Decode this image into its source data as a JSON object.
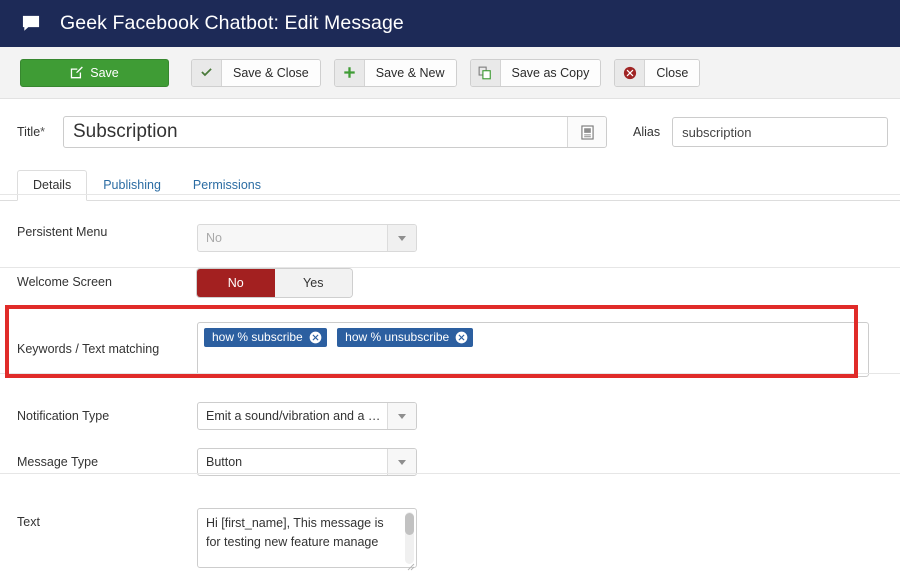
{
  "header": {
    "icon": "comment-icon",
    "title": "Geek Facebook Chatbot: Edit Message",
    "background": "#1d2a57"
  },
  "toolbar": {
    "save_label": "Save",
    "save_color": "#3f9c35",
    "buttons": [
      {
        "label": "Save & Close",
        "icon": "check-icon"
      },
      {
        "label": "Save & New",
        "icon": "plus-icon"
      },
      {
        "label": "Save as Copy",
        "icon": "copy-icon"
      },
      {
        "label": "Close",
        "icon": "cancel-circle-icon"
      }
    ]
  },
  "form": {
    "title_label": "Title",
    "title_required_marker": "*",
    "title_value": "Subscription",
    "title_button_icon": "article-icon",
    "alias_label": "Alias",
    "alias_value": "subscription"
  },
  "tabs": [
    {
      "label": "Details",
      "active": true
    },
    {
      "label": "Publishing",
      "active": false
    },
    {
      "label": "Permissions",
      "active": false
    }
  ],
  "fields": {
    "persistent_menu": {
      "label": "Persistent Menu",
      "value": "No",
      "disabled": true
    },
    "welcome_screen": {
      "label": "Welcome Screen",
      "options": [
        "No",
        "Yes"
      ],
      "selected": "No",
      "selected_color": "#a32020"
    },
    "keywords": {
      "label": "Keywords / Text matching",
      "tags": [
        "how % subscribe",
        "how % unsubscribe"
      ],
      "tag_color": "#2c5fa0",
      "highlight_color": "#e02b29"
    },
    "notification_type": {
      "label": "Notification Type",
      "value": "Emit a sound/vibration and a …"
    },
    "message_type": {
      "label": "Message Type",
      "value": "Button"
    },
    "text": {
      "label": "Text",
      "value": "Hi [first_name], This message is for testing new feature manage"
    }
  }
}
